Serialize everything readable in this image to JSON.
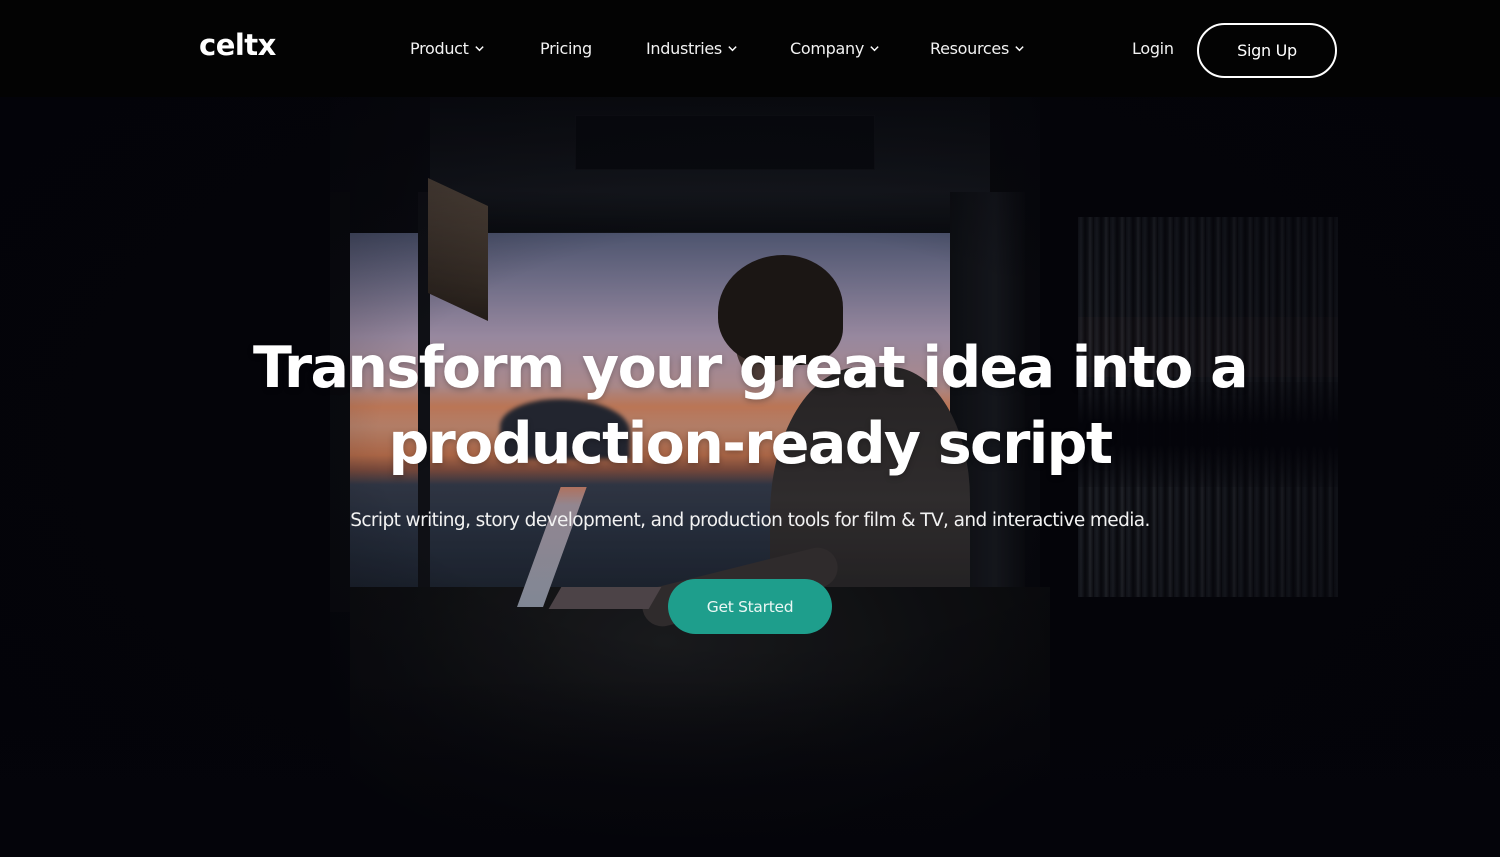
{
  "brand": {
    "logo_text": "celtx"
  },
  "nav": {
    "items": [
      {
        "label": "Product",
        "has_dropdown": true,
        "icon": "chevron-down-icon"
      },
      {
        "label": "Pricing",
        "has_dropdown": false
      },
      {
        "label": "Industries",
        "has_dropdown": true,
        "icon": "chevron-down-icon"
      },
      {
        "label": "Company",
        "has_dropdown": true,
        "icon": "chevron-down-icon"
      },
      {
        "label": "Resources",
        "has_dropdown": true,
        "icon": "chevron-down-icon"
      }
    ],
    "login_label": "Login",
    "signup_label": "Sign Up"
  },
  "hero": {
    "title_line1": "Transform your great idea into a",
    "title_line2": "production-ready script",
    "subtitle": "Script writing, story development, and production tools for film & TV, and interactive media.",
    "cta_label": "Get Started",
    "background_image": "person typing on laptop inside camper van at sunset by the sea"
  },
  "colors": {
    "nav_background": "#030303",
    "hero_background": "#05050c",
    "cta_background": "#1e9e8c",
    "text": "#ffffff"
  }
}
